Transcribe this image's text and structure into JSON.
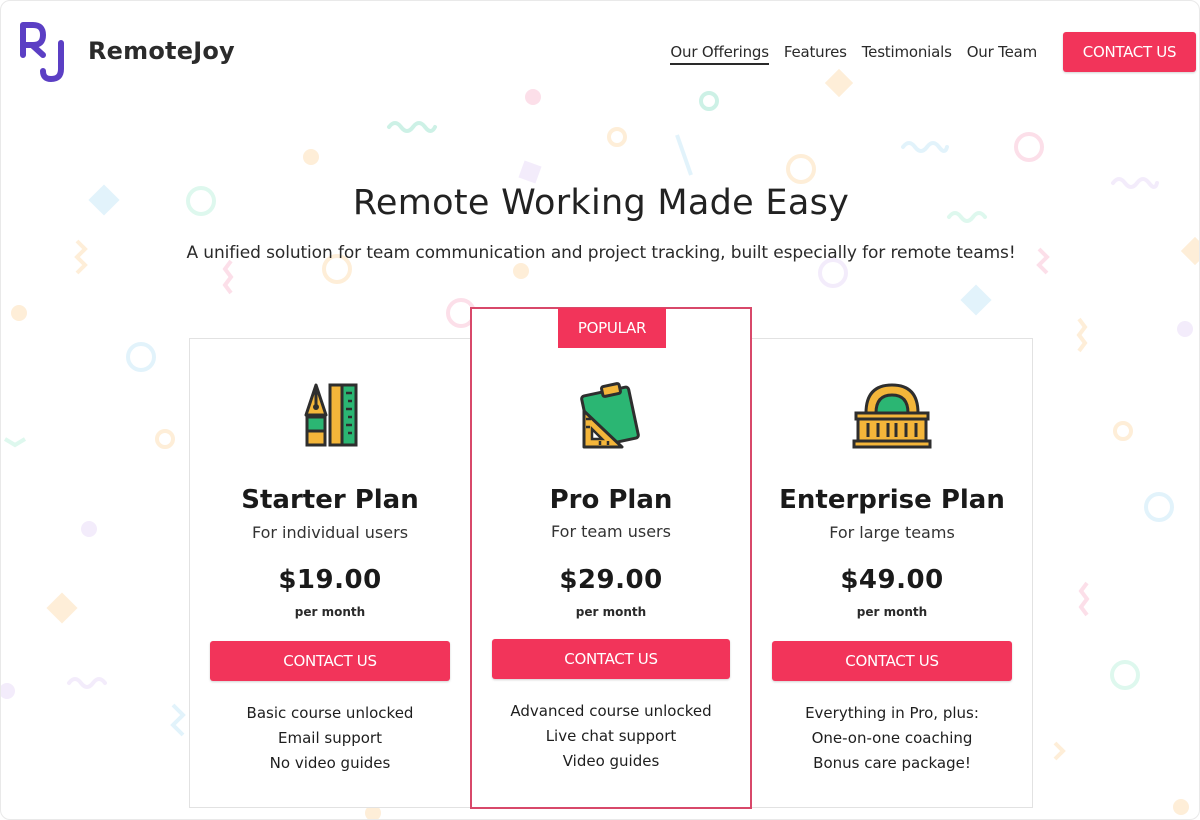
{
  "brand": {
    "logo_letters": "RJ",
    "name": "RemoteJoy"
  },
  "nav": {
    "links": [
      "Our Offerings",
      "Features",
      "Testimonials",
      "Our Team"
    ],
    "active_index": 0,
    "contact_label": "CONTACT US"
  },
  "hero": {
    "title": "Remote Working Made Easy",
    "subtitle": "A unified solution for team communication and project tracking, built especially for remote teams!"
  },
  "plans": [
    {
      "id": "starter",
      "icon": "pen-ruler-icon",
      "name": "Starter Plan",
      "description": "For individual users",
      "price": "$19.00",
      "period": "per month",
      "button": "CONTACT US",
      "features": [
        "Basic course unlocked",
        "Email support",
        "No video guides"
      ]
    },
    {
      "id": "pro",
      "badge": "POPULAR",
      "icon": "clipboard-setsquare-icon",
      "name": "Pro Plan",
      "description": "For team users",
      "price": "$29.00",
      "period": "per month",
      "button": "CONTACT US",
      "features": [
        "Advanced course unlocked",
        "Live chat support",
        "Video guides"
      ]
    },
    {
      "id": "enterprise",
      "icon": "building-icon",
      "name": "Enterprise Plan",
      "description": "For large teams",
      "price": "$49.00",
      "period": "per month",
      "button": "CONTACT US",
      "features": [
        "Everything in Pro, plus:",
        "One-on-one coaching",
        "Bonus care package!"
      ]
    }
  ],
  "colors": {
    "accent": "#f2345a",
    "logo": "#5b3fc4",
    "popular_border": "#d8486a",
    "icon_gold": "#f4b63a",
    "icon_green": "#2bb673",
    "icon_outline": "#2e2e2e"
  }
}
